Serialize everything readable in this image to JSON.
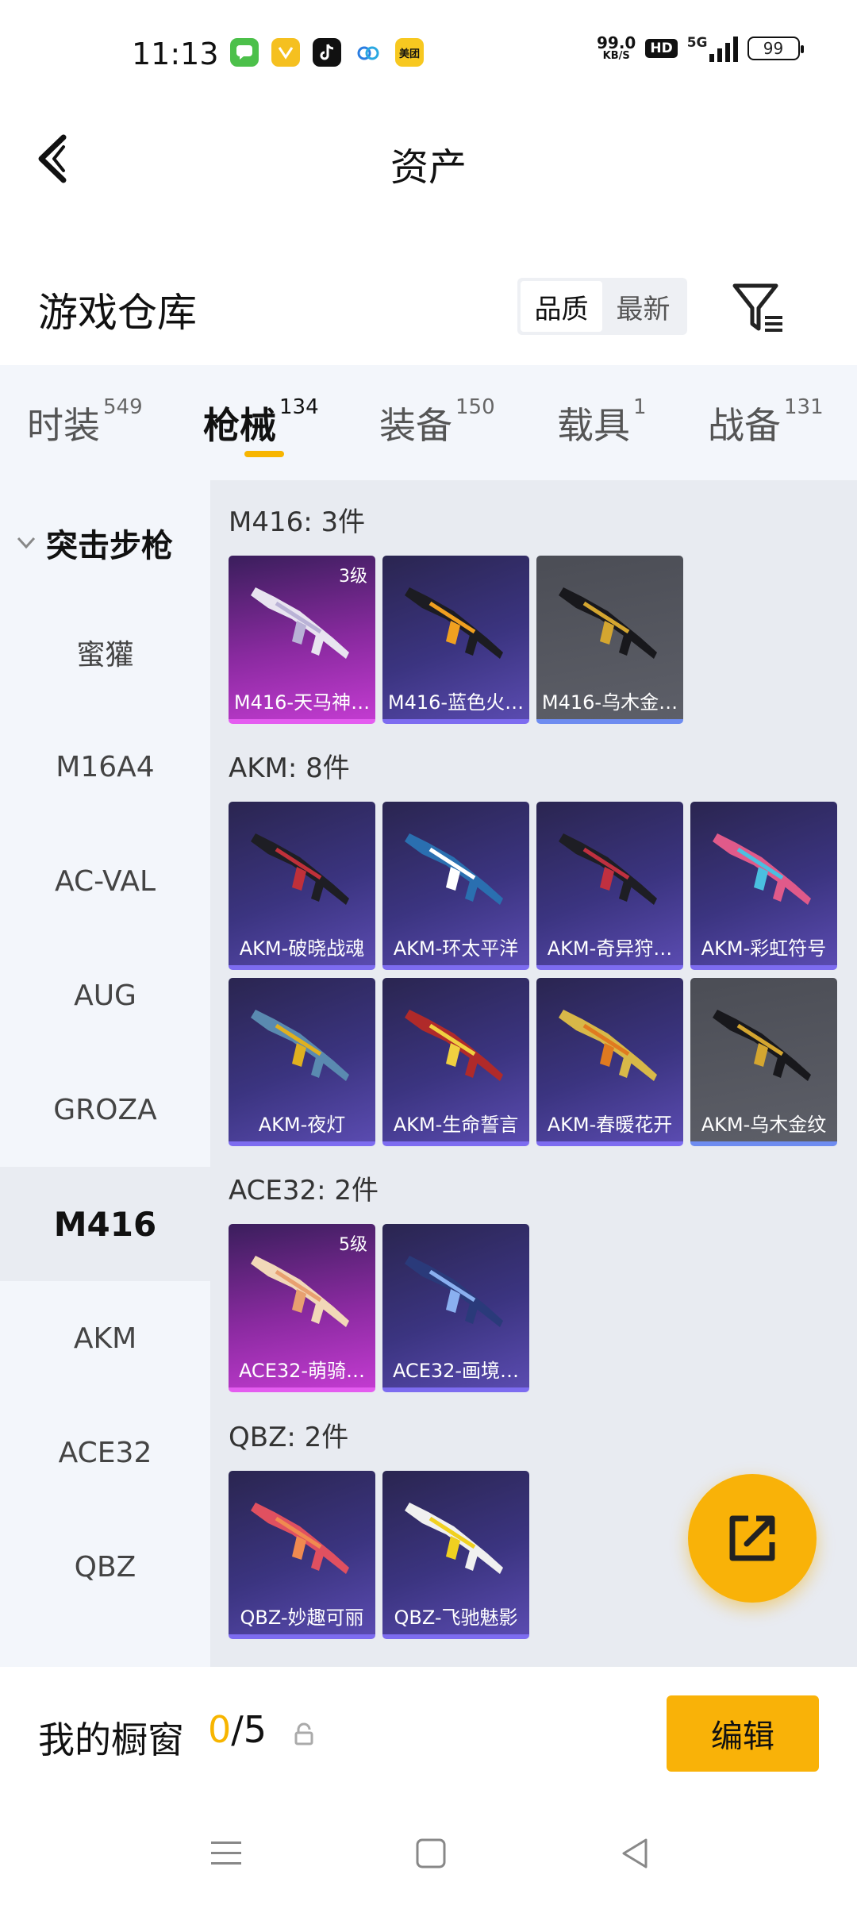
{
  "status_bar": {
    "time": "11:13",
    "net_speed_value": "99.0",
    "net_speed_unit": "KB/S",
    "hd": "HD",
    "network": "5G",
    "battery": "99",
    "app_icons": [
      "messages-icon",
      "notes-icon",
      "tiktok-icon",
      "cloud-icon",
      "meituan-icon"
    ],
    "meituan_label": "美团"
  },
  "header": {
    "title": "资产"
  },
  "warehouse": {
    "title": "游戏仓库",
    "sort_options": [
      "品质",
      "最新"
    ],
    "active_sort": "品质"
  },
  "tabs": [
    {
      "label": "时装",
      "count": "549"
    },
    {
      "label": "枪械",
      "count": "134"
    },
    {
      "label": "装备",
      "count": "150"
    },
    {
      "label": "载具",
      "count": "1"
    },
    {
      "label": "战备",
      "count": "131"
    }
  ],
  "sidebar": {
    "category": "突击步枪",
    "items": [
      "蜜獾",
      "M16A4",
      "AC-VAL",
      "AUG",
      "GROZA",
      "M416",
      "AKM",
      "ACE32",
      "QBZ"
    ],
    "active": "M416"
  },
  "groups": [
    {
      "title": "M416: 3件",
      "items": [
        {
          "label": "M416-天马神…",
          "level": "3级",
          "rarity": "pink",
          "gun_color": "#e8e4f0",
          "accent": "#b9b2d6"
        },
        {
          "label": "M416-蓝色火…",
          "rarity": "purple",
          "gun_color": "#1c1c22",
          "accent": "#f0a020"
        },
        {
          "label": "M416-乌木金…",
          "rarity": "grey",
          "gun_color": "#18181c",
          "accent": "#d4a630"
        }
      ]
    },
    {
      "title": "AKM: 8件",
      "items": [
        {
          "label": "AKM-破晓战魂",
          "rarity": "purple",
          "gun_color": "#1e1e24",
          "accent": "#c0303a"
        },
        {
          "label": "AKM-环太平洋",
          "rarity": "purple",
          "gun_color": "#2a6fb0",
          "accent": "#ffffff"
        },
        {
          "label": "AKM-奇异狩…",
          "rarity": "purple",
          "gun_color": "#1e1e24",
          "accent": "#c03040"
        },
        {
          "label": "AKM-彩虹符号",
          "rarity": "purple",
          "gun_color": "#e05a8a",
          "accent": "#4ac0e0"
        },
        {
          "label": "AKM-夜灯",
          "rarity": "purple",
          "gun_color": "#5a8ab0",
          "accent": "#e0b020"
        },
        {
          "label": "AKM-生命誓言",
          "rarity": "purple",
          "gun_color": "#b02a2a",
          "accent": "#f0d040"
        },
        {
          "label": "AKM-春暖花开",
          "rarity": "purple",
          "gun_color": "#d8b848",
          "accent": "#e07a20"
        },
        {
          "label": "AKM-乌木金纹",
          "rarity": "grey",
          "gun_color": "#18181c",
          "accent": "#d4a630"
        }
      ]
    },
    {
      "title": "ACE32: 2件",
      "items": [
        {
          "label": "ACE32-萌骑…",
          "level": "5级",
          "rarity": "pink",
          "gun_color": "#f2d8b8",
          "accent": "#e8a070"
        },
        {
          "label": "ACE32-画境…",
          "rarity": "purple",
          "gun_color": "#2a3a7a",
          "accent": "#8ab0f0"
        }
      ]
    },
    {
      "title": "QBZ: 2件",
      "items": [
        {
          "label": "QBZ-妙趣可丽",
          "rarity": "purple",
          "gun_color": "#e05060",
          "accent": "#f08a50"
        },
        {
          "label": "QBZ-飞驰魅影",
          "rarity": "purple",
          "gun_color": "#f0f0f0",
          "accent": "#f0d020"
        }
      ]
    }
  ],
  "showcase": {
    "title": "我的橱窗",
    "current": "0",
    "total": "/5",
    "edit_label": "编辑"
  },
  "colors": {
    "accent": "#f9b208",
    "page_bg": "#ffffff",
    "panel_bg": "#e8ebf1",
    "sidebar_bg": "#f3f6fb"
  }
}
